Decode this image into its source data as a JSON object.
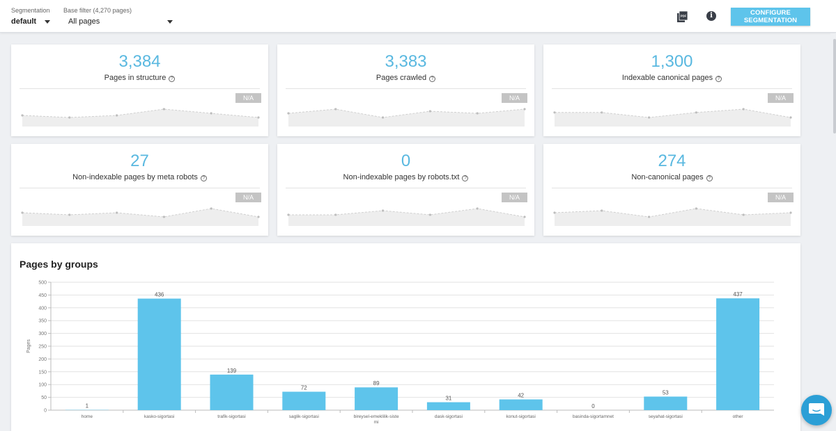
{
  "header": {
    "segmentation": {
      "label": "Segmentation",
      "value": "default"
    },
    "base_filter": {
      "label": "Base filter (4,270 pages)",
      "value": "All pages"
    },
    "configure_button": "CONFIGURE SEGMENTATION",
    "pdf_icon": "pdf-icon",
    "info_icon": "info-icon",
    "info_glyph": "i"
  },
  "cards": [
    {
      "value": "3,384",
      "title": "Pages in structure",
      "badge": "N/A",
      "trend": [
        2,
        1,
        2,
        5,
        3,
        1
      ]
    },
    {
      "value": "3,383",
      "title": "Pages crawled",
      "badge": "N/A",
      "trend": [
        2,
        4,
        0,
        3,
        2,
        4
      ]
    },
    {
      "value": "1,300",
      "title": "Indexable canonical pages",
      "badge": "N/A",
      "trend": [
        3,
        3,
        0,
        3,
        5,
        0
      ]
    },
    {
      "value": "27",
      "title": "Non-indexable pages by meta robots",
      "badge": "N/A",
      "trend": [
        2,
        1,
        2,
        0,
        4,
        0
      ]
    },
    {
      "value": "0",
      "title": "Non-indexable pages by robots.txt",
      "badge": "N/A",
      "trend": [
        1,
        1,
        3,
        1,
        4,
        0
      ]
    },
    {
      "value": "274",
      "title": "Non-canonical pages",
      "badge": "N/A",
      "trend": [
        2,
        3,
        0,
        4,
        1,
        2
      ]
    }
  ],
  "chart_data": {
    "type": "bar",
    "title": "Pages by groups",
    "ylabel": "Pages",
    "ylim": [
      0,
      500
    ],
    "yticks": [
      "0",
      "50",
      "100",
      "150",
      "200",
      "250",
      "300",
      "350",
      "400",
      "450",
      "500"
    ],
    "categories": [
      "home",
      "kasko-sigortasi",
      "trafik-sigortasi",
      "saglik-sigortasi",
      "bireysel-emeklilik-sistemi",
      "dask-sigortasi",
      "konut-sigortasi",
      "basinda-sigortamnet",
      "seyahat-sigortasi",
      "other"
    ],
    "category_lines": [
      [
        "home"
      ],
      [
        "kasko-sigortasi"
      ],
      [
        "trafik-sigortasi"
      ],
      [
        "saglik-sigortasi"
      ],
      [
        "bireysel-emeklilik-siste",
        "mi"
      ],
      [
        "dask-sigortasi"
      ],
      [
        "konut-sigortasi"
      ],
      [
        "basinda-sigortamnet"
      ],
      [
        "seyahat-sigortasi"
      ],
      [
        "other"
      ]
    ],
    "values": [
      1,
      436,
      139,
      72,
      89,
      31,
      42,
      0,
      53,
      437
    ],
    "value_labels": [
      "1",
      "436",
      "139",
      "72",
      "89",
      "31",
      "42",
      "0",
      "53",
      "437"
    ],
    "grid": true,
    "color": "#5ec4eb"
  },
  "colors": {
    "accent": "#5ec4eb",
    "value": "#59b8e0",
    "chat": "#2b9fd6"
  }
}
